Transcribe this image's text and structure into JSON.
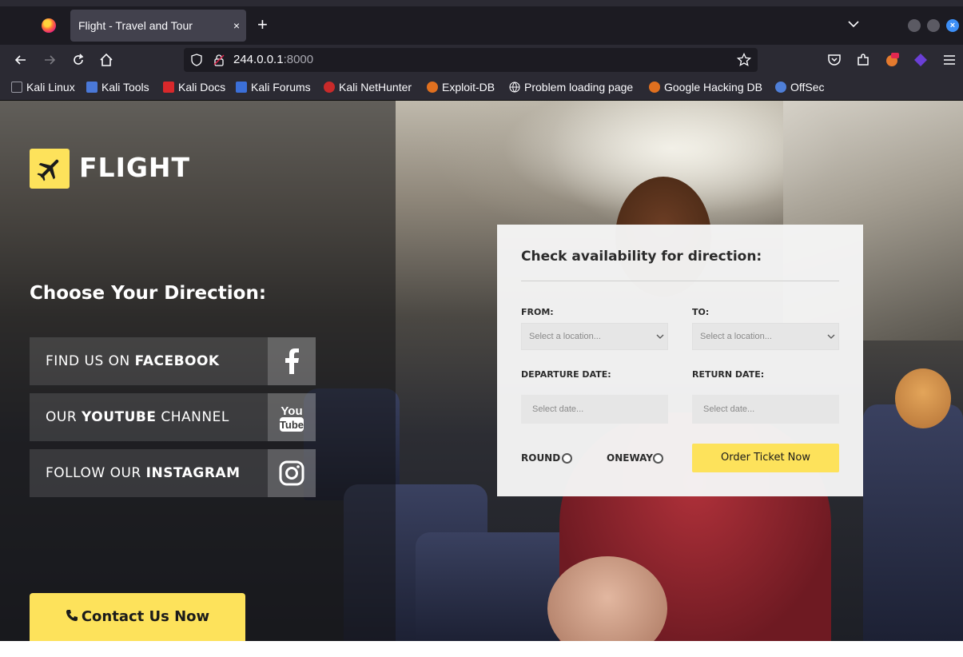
{
  "browser": {
    "tab_title": "Flight - Travel and Tour",
    "tab_close": "×",
    "new_tab": "+",
    "url_host": "244.0.0.1",
    "url_port": ":8000",
    "bookmarks": [
      "Kali Linux",
      "Kali Tools",
      "Kali Docs",
      "Kali Forums",
      "Kali NetHunter",
      "Exploit-DB",
      "Problem loading page",
      "Google Hacking DB",
      "OffSec"
    ],
    "window_close": "×"
  },
  "site": {
    "logo_text": "FLIGHT",
    "choose_heading": "Choose Your Direction:",
    "social": [
      {
        "pre": "FIND US ON ",
        "bold": "FACEBOOK",
        "post": "",
        "icon": "facebook-icon"
      },
      {
        "pre": "OUR ",
        "bold": "YOUTUBE",
        "post": " CHANNEL",
        "icon": "youtube-icon"
      },
      {
        "pre": "FOLLOW OUR ",
        "bold": "INSTAGRAM",
        "post": "",
        "icon": "instagram-icon"
      }
    ],
    "contact_label": "Contact Us Now",
    "accent_color": "#fde25b"
  },
  "form": {
    "title": "Check availability for direction:",
    "from_label": "FROM:",
    "to_label": "TO:",
    "from_placeholder": "Select a location...",
    "to_placeholder": "Select a location...",
    "departure_label": "DEPARTURE DATE:",
    "return_label": "RETURN DATE:",
    "departure_placeholder": "Select date...",
    "return_placeholder": "Select date...",
    "round_label": "ROUND",
    "oneway_label": "ONEWAY",
    "order_label": "Order Ticket Now"
  }
}
